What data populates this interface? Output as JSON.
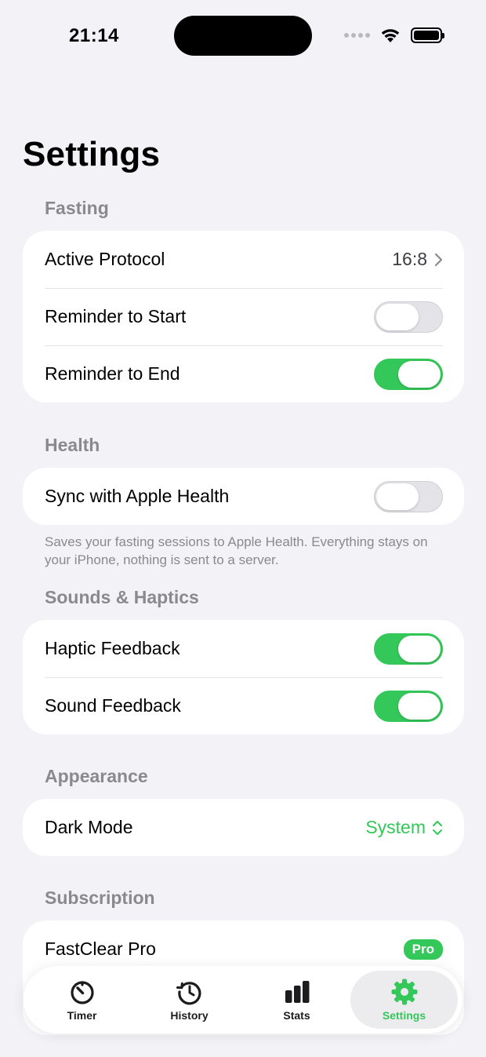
{
  "status_bar": {
    "time": "21:14"
  },
  "title": "Settings",
  "sections": {
    "fasting": {
      "header": "Fasting",
      "active_protocol": {
        "label": "Active Protocol",
        "value": "16:8"
      },
      "reminder_start": {
        "label": "Reminder to Start",
        "on": false
      },
      "reminder_end": {
        "label": "Reminder to End",
        "on": true
      }
    },
    "health": {
      "header": "Health",
      "sync": {
        "label": "Sync with Apple Health",
        "on": false
      },
      "footnote": "Saves your fasting sessions to Apple Health. Everything stays on your iPhone, nothing is sent to a server."
    },
    "sounds": {
      "header": "Sounds & Haptics",
      "haptic": {
        "label": "Haptic Feedback",
        "on": true
      },
      "sound": {
        "label": "Sound Feedback",
        "on": true
      }
    },
    "appearance": {
      "header": "Appearance",
      "dark_mode": {
        "label": "Dark Mode",
        "value": "System"
      }
    },
    "subscription": {
      "header": "Subscription",
      "pro": {
        "label": "FastClear Pro",
        "badge": "Pro"
      }
    }
  },
  "tabs": [
    {
      "label": "Timer",
      "icon": "timer-icon"
    },
    {
      "label": "History",
      "icon": "history-icon"
    },
    {
      "label": "Stats",
      "icon": "stats-icon"
    },
    {
      "label": "Settings",
      "icon": "gear-icon",
      "active": true
    }
  ],
  "colors": {
    "accent": "#34c759",
    "background": "#f2f2f7",
    "secondary_text": "#8a8a8e"
  }
}
